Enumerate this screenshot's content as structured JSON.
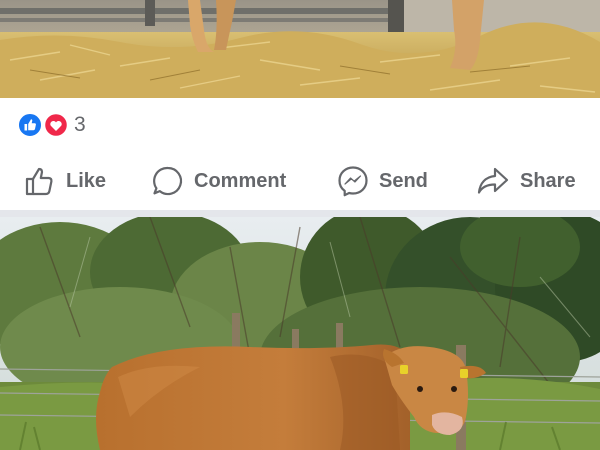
{
  "post_top": {
    "photo_icon": "photo-straw-bedding-calf"
  },
  "reactions": {
    "icons": [
      "like-reaction-icon",
      "love-reaction-icon"
    ],
    "count": "3",
    "like_color": "#1877f2",
    "love_color": "#f0284a"
  },
  "actions": {
    "like_label": "Like",
    "comment_label": "Comment",
    "send_label": "Send",
    "share_label": "Share",
    "text_color": "#65676b"
  },
  "post_bottom": {
    "photo_icon": "photo-bull-in-field"
  }
}
